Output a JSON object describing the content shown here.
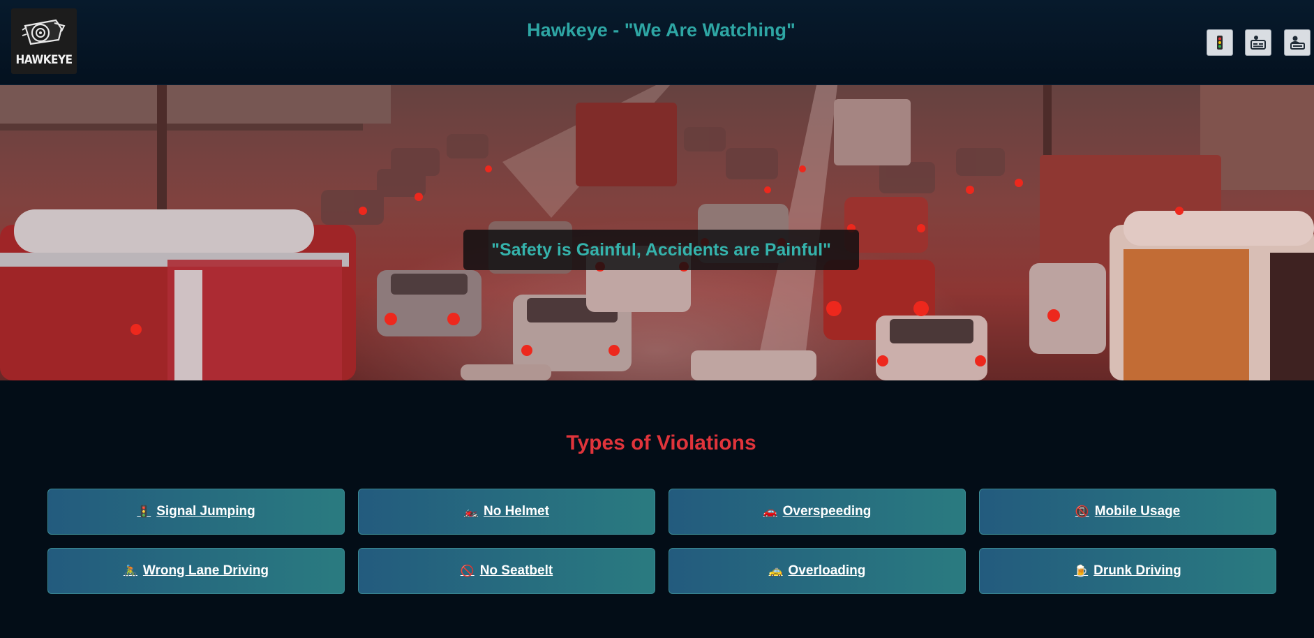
{
  "header": {
    "logo_text": "HAWKEYE",
    "title": "Hawkeye - \"We Are Watching\"",
    "nav": [
      {
        "name": "traffic-light-icon"
      },
      {
        "name": "id-card-icon"
      },
      {
        "name": "user-card-icon"
      }
    ]
  },
  "hero": {
    "tagline": "\"Safety is Gainful, Accidents are Painful\""
  },
  "violations_section": {
    "title": "Types of Violations",
    "items": [
      {
        "icon": "🚦",
        "label": "Signal Jumping"
      },
      {
        "icon": "🏍️",
        "label": "No Helmet"
      },
      {
        "icon": "🚗",
        "label": "Overspeeding"
      },
      {
        "icon": "📵",
        "label": "Mobile Usage"
      },
      {
        "icon": "🚴",
        "label": "Wrong Lane Driving"
      },
      {
        "icon": "🚫",
        "label": "No Seatbelt"
      },
      {
        "icon": "🚕",
        "label": "Overloading"
      },
      {
        "icon": "🍺",
        "label": "Drunk Driving"
      }
    ]
  },
  "colors": {
    "background": "#030d17",
    "title_teal": "#2ea6a4",
    "section_red": "#e0343b"
  }
}
